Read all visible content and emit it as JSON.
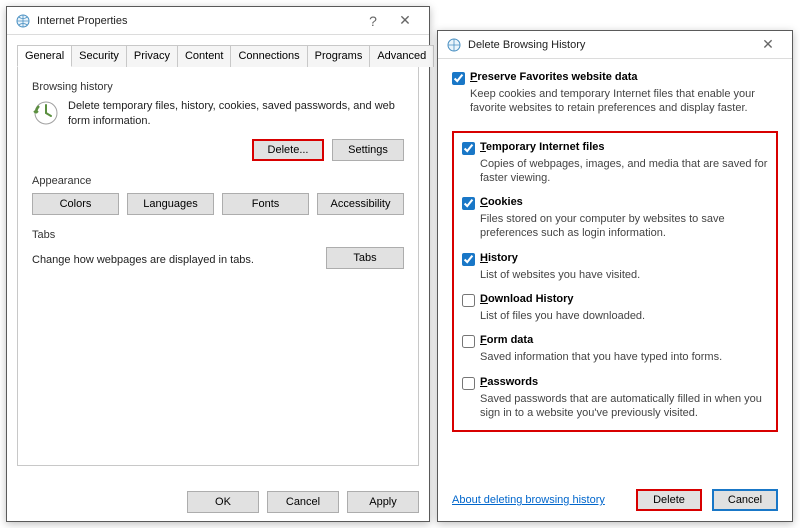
{
  "ip": {
    "title": "Internet Properties",
    "tabs": [
      {
        "label": "General"
      },
      {
        "label": "Security"
      },
      {
        "label": "Privacy"
      },
      {
        "label": "Content"
      },
      {
        "label": "Connections"
      },
      {
        "label": "Programs"
      },
      {
        "label": "Advanced"
      }
    ],
    "bh": {
      "group_label": "Browsing history",
      "text": "Delete temporary files, history, cookies, saved passwords, and web form information.",
      "delete_btn": "Delete...",
      "settings_btn": "Settings"
    },
    "appearance": {
      "group_label": "Appearance",
      "colors_btn": "Colors",
      "languages_btn": "Languages",
      "fonts_btn": "Fonts",
      "accessibility_btn": "Accessibility"
    },
    "tabs_section": {
      "group_label": "Tabs",
      "text": "Change how webpages are displayed in tabs.",
      "tabs_btn": "Tabs"
    },
    "footer": {
      "ok_btn": "OK",
      "cancel_btn": "Cancel",
      "apply_btn": "Apply"
    }
  },
  "dbh": {
    "title": "Delete Browsing History",
    "options": [
      {
        "key": "favorites",
        "checked": true,
        "label_prefix": "P",
        "label_rest": "reserve Favorites website data",
        "desc": "Keep cookies and temporary Internet files that enable your favorite websites to retain preferences and display faster."
      },
      {
        "key": "temp",
        "checked": true,
        "label_prefix": "T",
        "label_rest": "emporary Internet files",
        "desc": "Copies of webpages, images, and media that are saved for faster viewing."
      },
      {
        "key": "cookies",
        "checked": true,
        "label_prefix": "C",
        "label_rest": "ookies",
        "desc": "Files stored on your computer by websites to save preferences such as login information."
      },
      {
        "key": "history",
        "checked": true,
        "label_prefix": "H",
        "label_rest": "istory",
        "desc": "List of websites you have visited."
      },
      {
        "key": "downloads",
        "checked": false,
        "label_prefix": "D",
        "label_rest": "ownload History",
        "desc": "List of files you have downloaded."
      },
      {
        "key": "formdata",
        "checked": false,
        "label_prefix": "F",
        "label_rest": "orm data",
        "desc": "Saved information that you have typed into forms."
      },
      {
        "key": "passwords",
        "checked": false,
        "label_prefix": "P",
        "label_rest": "asswords",
        "desc": "Saved passwords that are automatically filled in when you sign in to a website you've previously visited."
      }
    ],
    "footer": {
      "about_link": "About deleting browsing history",
      "delete_btn": "Delete",
      "cancel_btn": "Cancel"
    }
  }
}
